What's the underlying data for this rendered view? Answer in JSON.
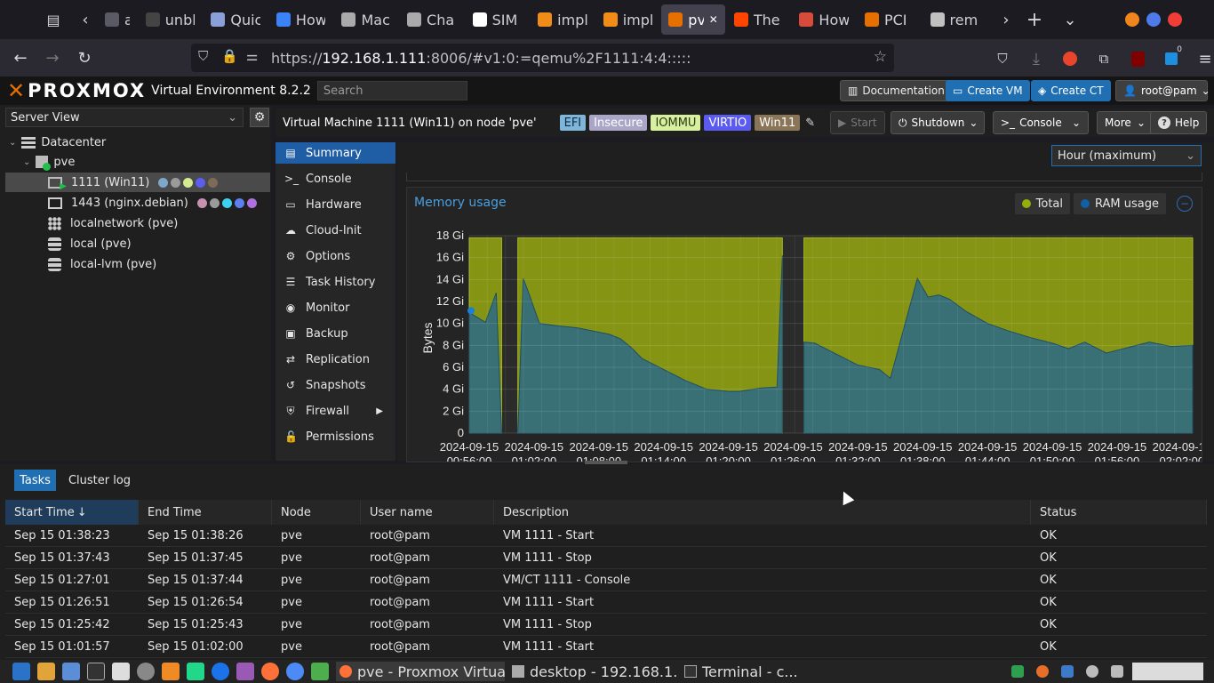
{
  "browser": {
    "tabs": [
      {
        "label": "ac",
        "color": "#5a5a66"
      },
      {
        "label": "unbl",
        "color": "#444"
      },
      {
        "label": "Quic",
        "color": "#8aa0d8"
      },
      {
        "label": "How",
        "color": "#3b82f6"
      },
      {
        "label": "Mac",
        "color": "#aaaaaa"
      },
      {
        "label": "Cha",
        "color": "#aaaaaa"
      },
      {
        "label": "SIM",
        "color": "#ffffff"
      },
      {
        "label": "impl",
        "color": "#f28c18"
      },
      {
        "label": "impl",
        "color": "#f28c18"
      },
      {
        "label": "pv",
        "color": "#e57000"
      },
      {
        "label": "The",
        "color": "#ff4500"
      },
      {
        "label": "How",
        "color": "#d64b3a"
      },
      {
        "label": "PCI",
        "color": "#e57000"
      },
      {
        "label": "rem",
        "color": "#c0c0c0"
      }
    ],
    "url_prefix": "https://",
    "url_host": "192.168.1.111",
    "url_rest": ":8006/#v1:0:=qemu%2F1111:4:4:::::",
    "extension_badge": "0"
  },
  "pve": {
    "logo_text": "PROXMOX",
    "product": "Virtual Environment 8.2.2",
    "search_placeholder": "Search",
    "buttons": {
      "documentation": "Documentation",
      "create_vm": "Create VM",
      "create_ct": "Create CT",
      "user": "root@pam"
    }
  },
  "tree": {
    "view_label": "Server View",
    "datacenter": "Datacenter",
    "node": "pve",
    "items": [
      {
        "label": "1111 (Win11)",
        "dots": [
          "#7ea7c9",
          "#9b9b9b",
          "#d4ec8f",
          "#5d5df0",
          "#7d6b58"
        ]
      },
      {
        "label": "1443 (nginx.debian)",
        "dots": [
          "#c890b0",
          "#9b9b9b",
          "#3dd3f0",
          "#5d7ff0",
          "#b070e0"
        ]
      },
      {
        "label": "localnetwork (pve)",
        "dots": []
      },
      {
        "label": "local (pve)",
        "dots": []
      },
      {
        "label": "local-lvm (pve)",
        "dots": []
      }
    ]
  },
  "vm": {
    "title": "Virtual Machine 1111 (Win11) on node 'pve'",
    "tags": [
      {
        "label": "EFI",
        "bg": "#7fb5d8",
        "fg": "#0b2a44"
      },
      {
        "label": "Insecure",
        "bg": "#a9a6c8",
        "fg": "#ffffff"
      },
      {
        "label": "IOMMU",
        "bg": "#d7f0a0",
        "fg": "#2b3a10"
      },
      {
        "label": "VIRTIO",
        "bg": "#5b5bf2",
        "fg": "#ffffff"
      },
      {
        "label": "Win11",
        "bg": "#8b7558",
        "fg": "#ffffff"
      }
    ],
    "actions": {
      "start": "Start",
      "shutdown": "Shutdown",
      "console": "Console",
      "more": "More",
      "help": "Help"
    }
  },
  "menu": [
    {
      "label": "Summary",
      "icon": "summary-icon",
      "glyph": "▤"
    },
    {
      "label": "Console",
      "icon": "console-icon",
      "glyph": ">_"
    },
    {
      "label": "Hardware",
      "icon": "monitor-icon",
      "glyph": "▭"
    },
    {
      "label": "Cloud-Init",
      "icon": "cloud-icon",
      "glyph": "☁"
    },
    {
      "label": "Options",
      "icon": "gear-icon",
      "glyph": "⚙"
    },
    {
      "label": "Task History",
      "icon": "list-icon",
      "glyph": "☰"
    },
    {
      "label": "Monitor",
      "icon": "eye-icon",
      "glyph": "◉"
    },
    {
      "label": "Backup",
      "icon": "save-icon",
      "glyph": "▣"
    },
    {
      "label": "Replication",
      "icon": "retweet-icon",
      "glyph": "⇄"
    },
    {
      "label": "Snapshots",
      "icon": "history-icon",
      "glyph": "↺"
    },
    {
      "label": "Firewall",
      "icon": "shield-icon",
      "glyph": "⛨"
    },
    {
      "label": "Permissions",
      "icon": "unlock-icon",
      "glyph": "🔓"
    }
  ],
  "timeframe": "Hour (maximum)",
  "chart": {
    "title": "Memory usage",
    "legend": [
      {
        "label": "Total",
        "color": "#94ae0a"
      },
      {
        "label": "RAM usage",
        "color": "#115fa6"
      }
    ],
    "ylabel": "Bytes",
    "yticks": [
      "18 Gi",
      "16 Gi",
      "14 Gi",
      "12 Gi",
      "10 Gi",
      "8 Gi",
      "6 Gi",
      "4 Gi",
      "2 Gi",
      "0"
    ],
    "xticks_date": "2024-09-15",
    "xticks_time": [
      "00:56:00",
      "01:02:00",
      "01:08:00",
      "01:14:00",
      "01:20:00",
      "01:26:00",
      "01:32:00",
      "01:38:00",
      "01:44:00",
      "01:50:00",
      "01:56:00",
      "02:02:00"
    ]
  },
  "chart_data": {
    "type": "area",
    "title": "Memory usage",
    "xlabel": "",
    "ylabel": "Bytes",
    "ylim": [
      0,
      18
    ],
    "xlim": [
      "2024-09-15 00:56:00",
      "2024-09-15 02:03:00"
    ],
    "series": [
      {
        "name": "Total",
        "color": "#94ae0a",
        "segments": [
          {
            "x": [
              "2024-09-15 00:56:00",
              "2024-09-15 00:59:00"
            ],
            "y": [
              17.8,
              17.8
            ]
          },
          {
            "x": [
              "2024-09-15 01:00:30",
              "2024-09-15 01:25:00"
            ],
            "y": [
              17.8,
              17.8
            ]
          },
          {
            "x": [
              "2024-09-15 01:27:00",
              "2024-09-15 02:03:00"
            ],
            "y": [
              17.8,
              17.8
            ]
          }
        ]
      },
      {
        "name": "RAM usage",
        "color": "#115fa6",
        "segments": [
          {
            "x": [
              "2024-09-15 00:56:00",
              "2024-09-15 00:56:30",
              "2024-09-15 00:57:30",
              "2024-09-15 00:58:30",
              "2024-09-15 00:59:00"
            ],
            "y": [
              11.0,
              10.7,
              10.1,
              12.8,
              0
            ]
          },
          {
            "x": [
              "2024-09-15 01:00:30",
              "2024-09-15 01:01:00",
              "2024-09-15 01:01:30",
              "2024-09-15 01:02:30",
              "2024-09-15 01:04:00",
              "2024-09-15 01:06:00",
              "2024-09-15 01:08:00",
              "2024-09-15 01:09:00",
              "2024-09-15 01:10:00",
              "2024-09-15 01:11:00",
              "2024-09-15 01:12:00",
              "2024-09-15 01:14:00",
              "2024-09-15 01:16:00",
              "2024-09-15 01:18:00",
              "2024-09-15 01:20:00",
              "2024-09-15 01:21:00",
              "2024-09-15 01:23:00",
              "2024-09-15 01:24:30",
              "2024-09-15 01:25:00"
            ],
            "y": [
              0,
              14.1,
              12.8,
              10.0,
              9.8,
              9.6,
              9.2,
              9.0,
              8.6,
              7.8,
              6.8,
              5.8,
              4.8,
              4.0,
              3.8,
              3.8,
              4.1,
              4.2,
              16.2
            ]
          },
          {
            "x": [
              "2024-09-15 01:27:00",
              "2024-09-15 01:28:00",
              "2024-09-15 01:30:00",
              "2024-09-15 01:32:00",
              "2024-09-15 01:34:00",
              "2024-09-15 01:35:00",
              "2024-09-15 01:37:30",
              "2024-09-15 01:38:30",
              "2024-09-15 01:39:30",
              "2024-09-15 01:40:30",
              "2024-09-15 01:42:00",
              "2024-09-15 01:44:00",
              "2024-09-15 01:46:00",
              "2024-09-15 01:48:00",
              "2024-09-15 01:50:00",
              "2024-09-15 01:51:30",
              "2024-09-15 01:53:00",
              "2024-09-15 01:55:00",
              "2024-09-15 01:57:00",
              "2024-09-15 01:59:00",
              "2024-09-15 02:01:00",
              "2024-09-15 02:03:00"
            ],
            "y": [
              8.3,
              8.2,
              7.2,
              6.2,
              5.8,
              5.0,
              14.1,
              12.4,
              12.6,
              12.2,
              11.1,
              10.0,
              9.3,
              8.7,
              8.2,
              7.7,
              8.3,
              7.3,
              7.8,
              8.3,
              7.9,
              8.0
            ]
          }
        ]
      }
    ],
    "legend_position": "top-right",
    "grid": true
  },
  "tasks": {
    "tabs": [
      "Tasks",
      "Cluster log"
    ],
    "columns": [
      "Start Time",
      "End Time",
      "Node",
      "User name",
      "Description",
      "Status"
    ],
    "sort_indicator": "↓",
    "rows": [
      {
        "start": "Sep 15 01:38:23",
        "end": "Sep 15 01:38:26",
        "node": "pve",
        "user": "root@pam",
        "desc": "VM 1111 - Start",
        "status": "OK"
      },
      {
        "start": "Sep 15 01:37:43",
        "end": "Sep 15 01:37:45",
        "node": "pve",
        "user": "root@pam",
        "desc": "VM 1111 - Stop",
        "status": "OK"
      },
      {
        "start": "Sep 15 01:27:01",
        "end": "Sep 15 01:37:44",
        "node": "pve",
        "user": "root@pam",
        "desc": "VM/CT 1111 - Console",
        "status": "OK"
      },
      {
        "start": "Sep 15 01:26:51",
        "end": "Sep 15 01:26:54",
        "node": "pve",
        "user": "root@pam",
        "desc": "VM 1111 - Start",
        "status": "OK"
      },
      {
        "start": "Sep 15 01:25:42",
        "end": "Sep 15 01:25:43",
        "node": "pve",
        "user": "root@pam",
        "desc": "VM 1111 - Stop",
        "status": "OK"
      },
      {
        "start": "Sep 15 01:01:57",
        "end": "Sep 15 01:02:00",
        "node": "pve",
        "user": "root@pam",
        "desc": "VM 1111 - Start",
        "status": "OK"
      }
    ]
  },
  "taskbar": {
    "windows": [
      {
        "label": "pve - Proxmox Virtua..."
      },
      {
        "label": "desktop - 192.168.1...."
      },
      {
        "label": "Terminal - c..."
      }
    ]
  }
}
